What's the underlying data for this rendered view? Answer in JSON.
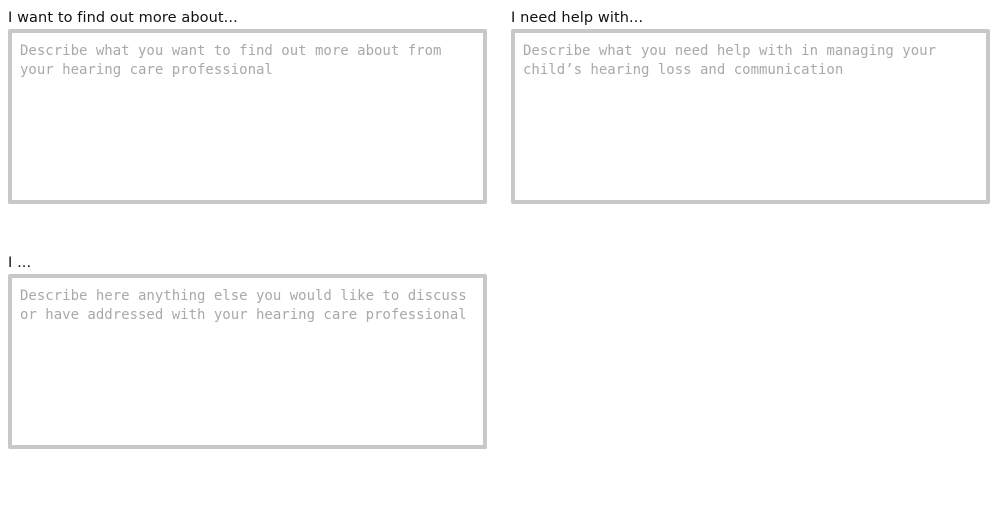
{
  "fields": {
    "find_out": {
      "label": "I want to find out more about...",
      "value": "",
      "placeholder": "Describe what you want to find out more about from your hearing care professional"
    },
    "help": {
      "label": "I need help with...",
      "value": "",
      "placeholder": "Describe what you need help with in managing your child’s hearing loss and communication"
    },
    "other": {
      "label": "I ...",
      "value": "",
      "placeholder": "Describe here anything else you would like to discuss or have addressed with your hearing care professional"
    }
  },
  "colors": {
    "border": "#c8c8c8",
    "placeholder": "#a9a9a9",
    "label": "#111111",
    "background": "#ffffff"
  }
}
